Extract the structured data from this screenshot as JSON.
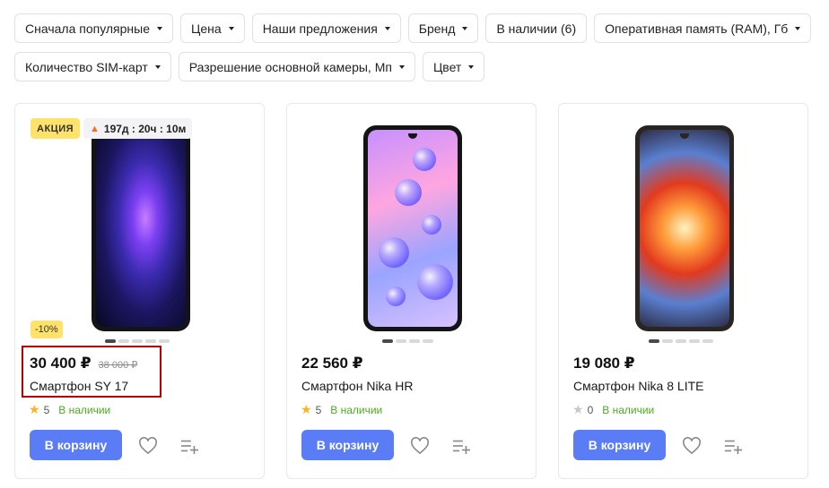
{
  "filters": {
    "row1": [
      {
        "label": "Сначала популярные"
      },
      {
        "label": "Цена"
      },
      {
        "label": "Наши предложения"
      },
      {
        "label": "Бренд"
      },
      {
        "label": "В наличии (6)"
      },
      {
        "label": "Оперативная память (RAM), Гб"
      }
    ],
    "row2": [
      {
        "label": "Количество SIM-карт"
      },
      {
        "label": "Разрешение основной камеры, Мп"
      },
      {
        "label": "Цвет"
      }
    ]
  },
  "products": [
    {
      "sale_badge": "АКЦИЯ",
      "timer": "197д : 20ч : 10м",
      "discount": "-10%",
      "price": "30 400 ₽",
      "old_price": "38 000 ₽",
      "title": "Смартфон SY 17",
      "rating": "5",
      "stock": "В наличии",
      "cart_label": "В корзину",
      "image_count": 5,
      "active_image": 1
    },
    {
      "price": "22 560 ₽",
      "title": "Смартфон Nika HR",
      "rating": "5",
      "stock": "В наличии",
      "cart_label": "В корзину",
      "image_count": 4,
      "active_image": 1
    },
    {
      "price": "19 080 ₽",
      "title": "Смартфон Nika 8 LITE",
      "rating": "0",
      "stock": "В наличии",
      "cart_label": "В корзину",
      "image_count": 5,
      "active_image": 1
    }
  ],
  "colors": {
    "accent": "#5a7df6",
    "sale_badge": "#ffe26a",
    "in_stock": "#4dad1e",
    "star": "#ffb21e",
    "highlight": "#b00000"
  },
  "icons": {
    "caret": "caret-down-icon",
    "flame": "flame-icon",
    "star": "star-icon",
    "favorite": "heart-icon",
    "compare": "compare-list-icon"
  }
}
